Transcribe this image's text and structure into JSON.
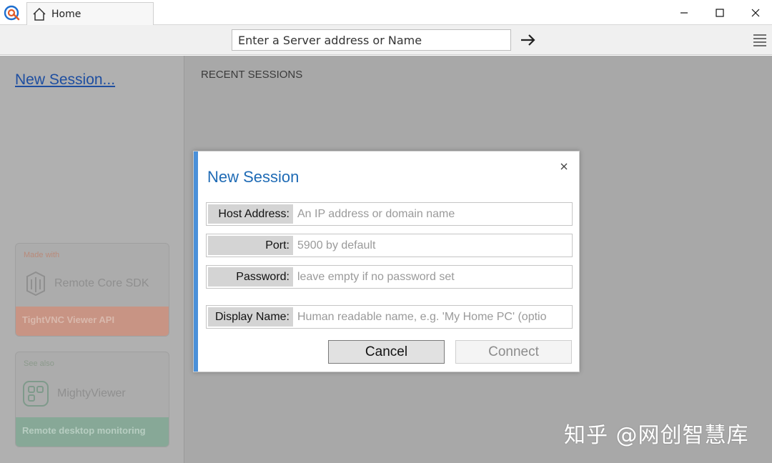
{
  "titlebar": {
    "tab_home_label": "Home"
  },
  "addressbar": {
    "server_placeholder": "Enter a Server address or Name"
  },
  "sidebar": {
    "new_session_link": "New Session...",
    "promo1": {
      "small": "Made with",
      "name": "Remote Core SDK",
      "band": "TightVNC Viewer API"
    },
    "promo2": {
      "small": "See also",
      "name": "MightyViewer",
      "band": "Remote desktop monitoring"
    }
  },
  "main": {
    "recent_title": "RECENT SESSIONS"
  },
  "dialog": {
    "title": "New Session",
    "fields": [
      {
        "label": "Host Address:",
        "placeholder": "An IP address or domain name"
      },
      {
        "label": "Port:",
        "placeholder": "5900 by default"
      },
      {
        "label": "Password:",
        "placeholder": "leave empty if no password set"
      },
      {
        "label": "Display Name:",
        "placeholder": "Human readable name, e.g. 'My Home PC' (optio"
      }
    ],
    "cancel_label": "Cancel",
    "connect_label": "Connect"
  },
  "watermark": "知乎 @网创智慧库",
  "colors": {
    "accent": "#4a90d9",
    "title_blue": "#1f6bb5",
    "link_blue": "#1e4ea0",
    "overlay_gray": "#a8a8a8"
  },
  "icons": [
    "app-logo-icon",
    "home-icon",
    "minimize-icon",
    "maximize-icon",
    "close-icon",
    "arrow-right-icon",
    "hamburger-menu-icon",
    "remote-core-logo-icon",
    "mightyviewer-logo-icon",
    "dialog-close-icon"
  ]
}
